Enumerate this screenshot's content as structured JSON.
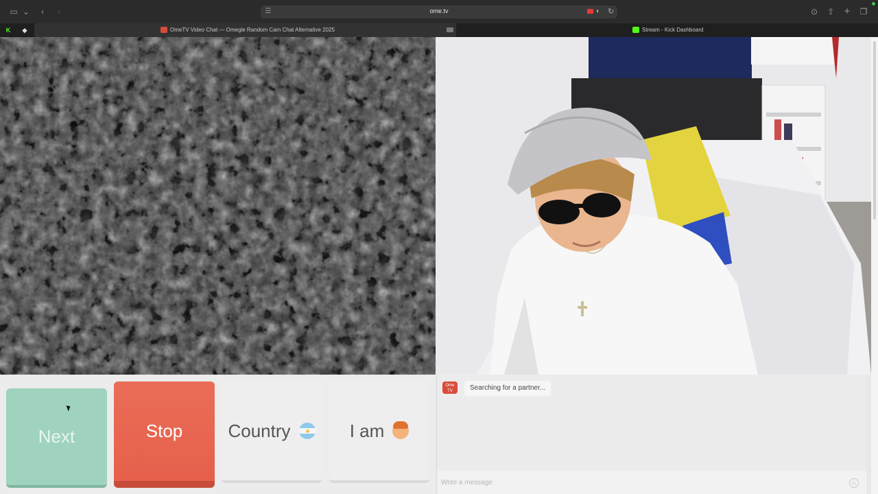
{
  "browser": {
    "url": "ome.tv",
    "tabs": [
      {
        "label": "OmeTV Video Chat — Omegle Random Cam Chat Alternative 2025",
        "active": true
      },
      {
        "label": "Stream - Kick Dashboard",
        "active": false
      }
    ],
    "pinned": [
      "K",
      "◆"
    ]
  },
  "controls": {
    "next_label": "Next",
    "stop_label": "Stop",
    "country_label": "Country",
    "iam_label": "I am"
  },
  "chat": {
    "status_message": "Searching for a partner...",
    "logo_text": [
      "Ome",
      "TV"
    ],
    "input_placeholder": "Write a message"
  },
  "colors": {
    "next": "#9fd3bd",
    "stop": "#e6604c",
    "brand": "#d94c3c"
  }
}
